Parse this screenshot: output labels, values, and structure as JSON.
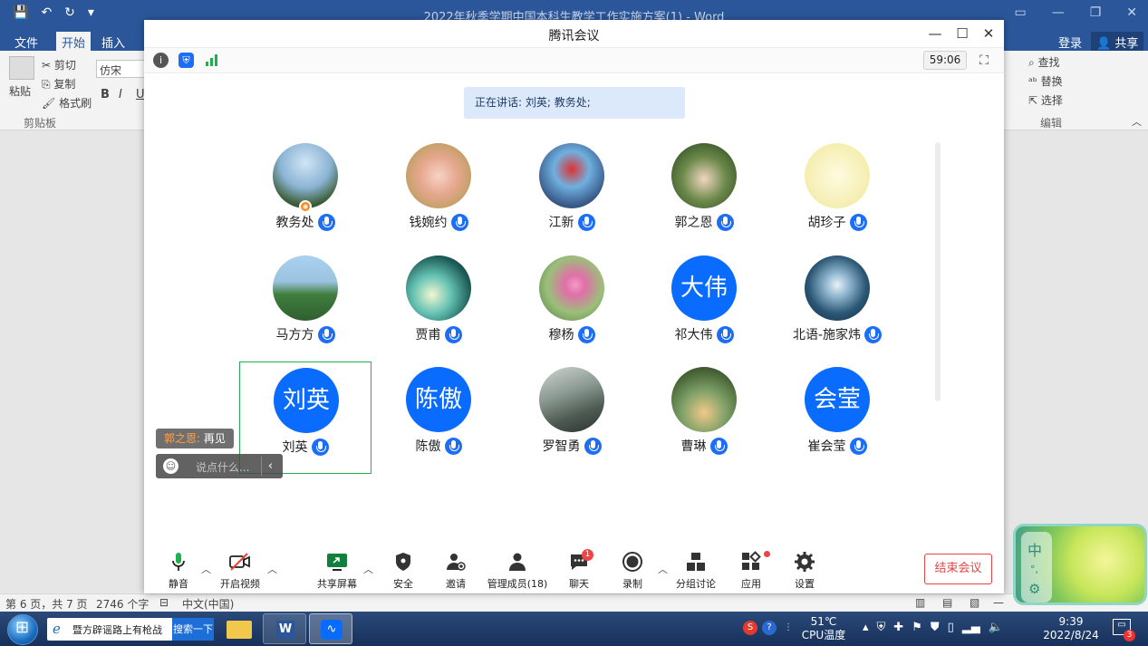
{
  "word": {
    "doc_title": "2022年秋季学期中国本科生教学工作实施方案(1) - Word",
    "tabs": [
      "文件",
      "开始",
      "插入"
    ],
    "account": "登录",
    "share": "共享",
    "clipboard": {
      "paste": "粘贴",
      "cut": "剪切",
      "copy": "复制",
      "format_painter": "格式刷",
      "group": "剪贴板"
    },
    "font_name": "仿宋",
    "format_buttons": [
      "B",
      "I",
      "U"
    ],
    "editing": {
      "find": "查找",
      "replace": "替换",
      "select": "选择",
      "group": "编辑"
    },
    "status": {
      "page": "第 6 页，共 7 页",
      "words": "2746 个字",
      "language": "中文(中国)"
    }
  },
  "meeting": {
    "title": "腾讯会议",
    "timer": "59:06",
    "speaking": "正在讲话: 刘英; 教务处;",
    "participants": [
      {
        "name": "教务处",
        "type": "image",
        "host": true
      },
      {
        "name": "钱婉约",
        "type": "image"
      },
      {
        "name": "江新",
        "type": "image"
      },
      {
        "name": "郭之恩",
        "type": "image"
      },
      {
        "name": "胡珍子",
        "type": "image"
      },
      {
        "name": "马方方",
        "type": "image"
      },
      {
        "name": "贾甫",
        "type": "image"
      },
      {
        "name": "穆杨",
        "type": "image"
      },
      {
        "name": "祁大伟",
        "type": "letter",
        "avatar_text": "大伟"
      },
      {
        "name": "北语-施家炜",
        "type": "image"
      },
      {
        "name": "刘英",
        "type": "letter",
        "avatar_text": "刘英",
        "active": true
      },
      {
        "name": "陈傲",
        "type": "letter",
        "avatar_text": "陈傲"
      },
      {
        "name": "罗智勇",
        "type": "image"
      },
      {
        "name": "曹琳",
        "type": "image"
      },
      {
        "name": "崔会莹",
        "type": "letter",
        "avatar_text": "会莹"
      }
    ],
    "chat": {
      "sender": "郭之恩:",
      "message": "再见",
      "placeholder": "说点什么..."
    },
    "toolbar": {
      "mute": "静音",
      "video": "开启视频",
      "share": "共享屏幕",
      "security": "安全",
      "invite": "邀请",
      "members": "管理成员(18)",
      "chat": "聊天",
      "chat_badge": "1",
      "record": "录制",
      "breakout": "分组讨论",
      "apps": "应用",
      "settings": "设置",
      "end": "结束会议"
    }
  },
  "taskbar": {
    "search_text": "暨方辟谣路上有枪战",
    "search_button": "搜索一下",
    "cpu_temp": "51℃",
    "cpu_label": "CPU温度",
    "time": "9:39",
    "date": "2022/8/24",
    "notify_count": "3"
  },
  "ime": {
    "mode": "中"
  },
  "colors": {
    "word_blue": "#2b579a",
    "meeting_blue": "#0a6cff",
    "end_red": "#e64545",
    "active_green": "#20b050"
  }
}
